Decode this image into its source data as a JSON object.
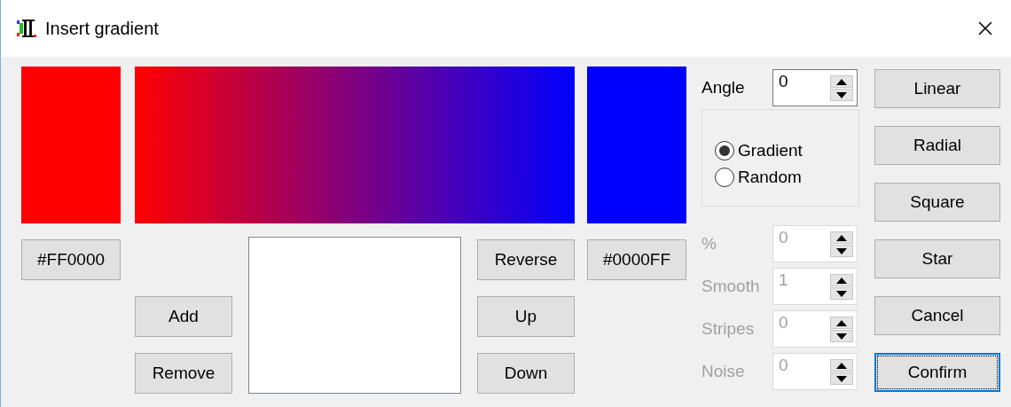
{
  "window": {
    "title": "Insert gradient"
  },
  "start_color": {
    "color": "#ff0000",
    "label": "#FF0000"
  },
  "end_color": {
    "color": "#0000ff",
    "label": "#0000FF"
  },
  "stop_buttons": [
    {
      "label": "Add"
    },
    {
      "label": "Remove"
    }
  ],
  "order_buttons": [
    {
      "label": "Reverse"
    },
    {
      "label": "Up"
    },
    {
      "label": "Down"
    }
  ],
  "angle": {
    "label": "Angle",
    "value": "0"
  },
  "mode": [
    {
      "label": "Gradient",
      "selected": true
    },
    {
      "label": "Random",
      "selected": false
    }
  ],
  "parameters": [
    {
      "label": "%",
      "value": "0",
      "disabled": true
    },
    {
      "label": "Smooth",
      "value": "1",
      "disabled": true
    },
    {
      "label": "Stripes",
      "value": "0",
      "disabled": true
    },
    {
      "label": "Noise",
      "value": "0",
      "disabled": true
    }
  ],
  "shape_buttons": [
    {
      "label": "Linear"
    },
    {
      "label": "Radial"
    },
    {
      "label": "Square"
    },
    {
      "label": "Star"
    }
  ],
  "dialog_buttons": [
    {
      "label": "Cancel",
      "focused": false
    },
    {
      "label": "Confirm",
      "focused": true
    }
  ]
}
